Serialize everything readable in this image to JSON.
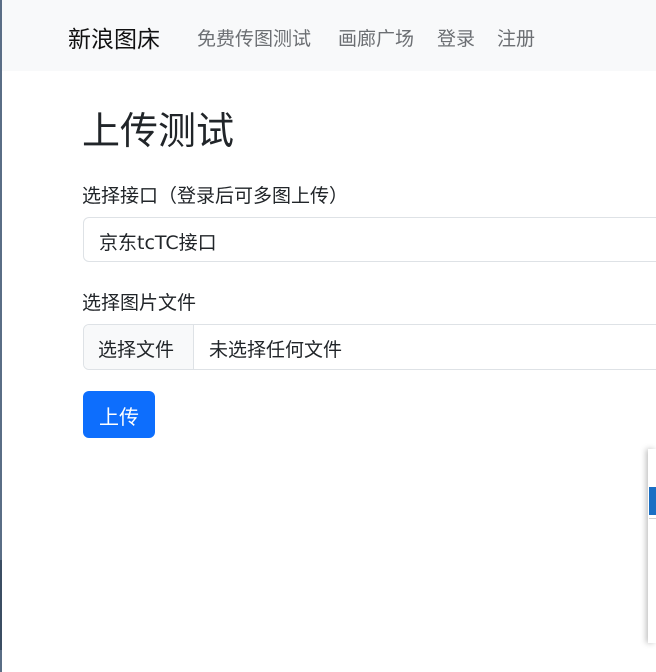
{
  "navbar": {
    "brand": "新浪图床",
    "links": [
      "免费传图测试",
      "画廊广场",
      "登录",
      "注册"
    ]
  },
  "main": {
    "title": "上传测试",
    "interface_label": "选择接口（登录后可多图上传）",
    "interface_selected": "京东tcTC接口",
    "file_label": "选择图片文件",
    "file_button": "选择文件",
    "file_status": "未选择任何文件",
    "upload_button": "上传"
  },
  "colors": {
    "primary": "#0d6efd",
    "navbar_bg": "#f8f9fa",
    "text": "#212529",
    "muted": "#6c6f73"
  }
}
